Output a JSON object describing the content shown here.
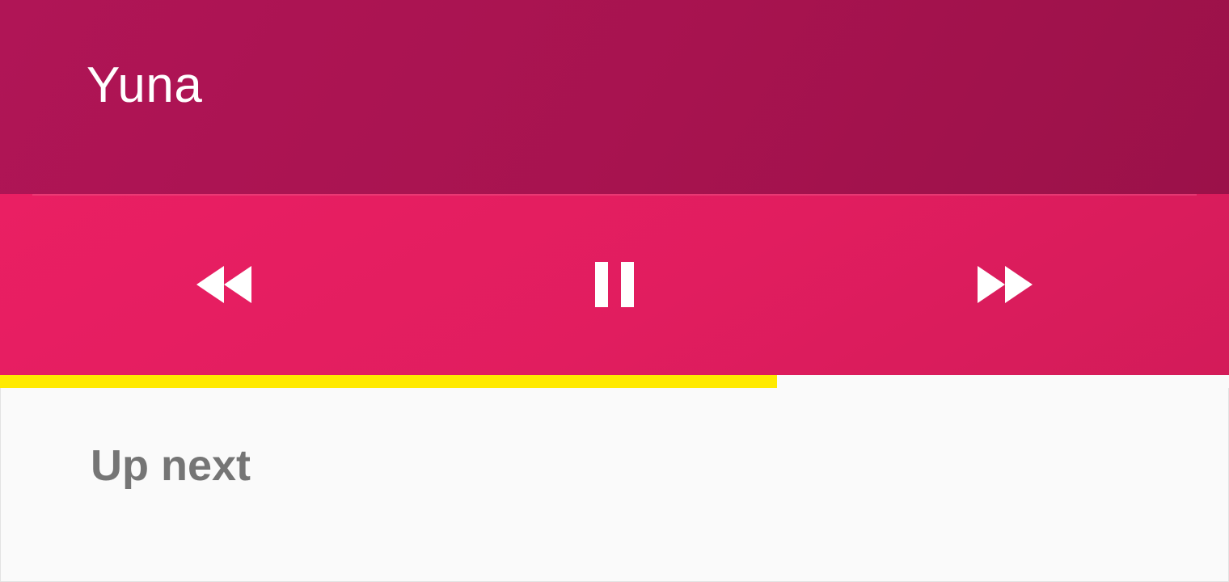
{
  "player": {
    "artist": "Yuna",
    "progress_fraction": 0.632,
    "colors": {
      "header": "#a91452",
      "controls": "#e21d60",
      "progress": "#ffea00",
      "background": "#fafafa",
      "subheading": "#757575"
    }
  },
  "controls": {
    "rewind_icon": "rewind-icon",
    "pause_icon": "pause-icon",
    "forward_icon": "fast-forward-icon"
  },
  "queue": {
    "title": "Up next"
  }
}
